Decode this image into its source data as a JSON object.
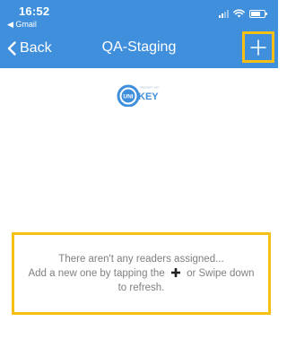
{
  "status_bar": {
    "time": "16:52",
    "back_app": "◀ Gmail",
    "icons": [
      "cellular-signal-icon",
      "wifi-icon",
      "battery-icon"
    ]
  },
  "nav_bar": {
    "back_label": "Back",
    "title": "QA-Staging",
    "add_icon": "plus-icon"
  },
  "logo": {
    "text": "UNI KEY",
    "tagline": "PROXIMITY KEY"
  },
  "empty_state": {
    "line1": "There aren't any readers assigned...",
    "line2_before": "Add a new one by tapping the",
    "line2_after": "or Swipe down",
    "line3": "to refresh."
  },
  "colors": {
    "header_bg": "#3f8fdc",
    "highlight": "#f5bf16",
    "empty_text": "#808080",
    "logo_primary": "#3f8fdc"
  }
}
